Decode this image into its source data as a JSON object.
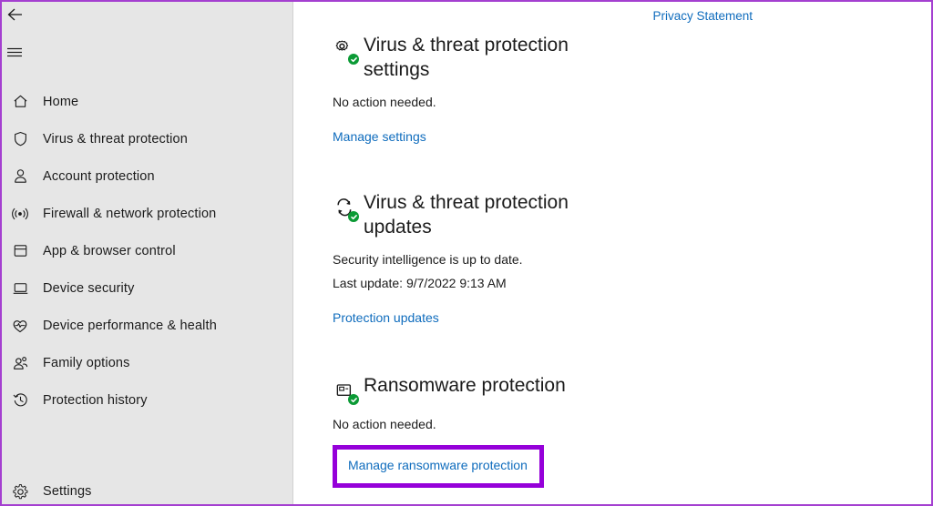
{
  "window": {
    "accent_highlight_color": "#9500d9",
    "window_border_color": "#a43fd0",
    "sidebar_bg": "#e6e6e6",
    "link_color": "#0f6cbd",
    "status_badge_color": "#0b9a35"
  },
  "sidebar": {
    "back_label": "Back",
    "menu_label": "Menu",
    "items": [
      {
        "label": "Home",
        "icon": "home-icon"
      },
      {
        "label": "Virus & threat protection",
        "icon": "shield-icon"
      },
      {
        "label": "Account protection",
        "icon": "person-icon"
      },
      {
        "label": "Firewall & network protection",
        "icon": "wireless-signal-icon"
      },
      {
        "label": "App & browser control",
        "icon": "app-window-icon"
      },
      {
        "label": "Device security",
        "icon": "monitor-icon"
      },
      {
        "label": "Device performance & health",
        "icon": "heart-pulse-icon"
      },
      {
        "label": "Family options",
        "icon": "people-icon"
      },
      {
        "label": "Protection history",
        "icon": "history-clock-icon"
      }
    ],
    "settings": {
      "label": "Settings",
      "icon": "gear-icon"
    }
  },
  "content": {
    "privacy_statement_link": "Privacy Statement",
    "sections": [
      {
        "title": "Virus & threat protection settings",
        "status": "No action needed.",
        "link": "Manage settings",
        "icon": "gear-check-icon"
      },
      {
        "title": "Virus & threat protection updates",
        "status": "Security intelligence is up to date.",
        "sub": "Last update: 9/7/2022 9:13 AM",
        "link": "Protection updates",
        "icon": "refresh-check-icon"
      },
      {
        "title": "Ransomware protection",
        "status": "No action needed.",
        "link": "Manage ransomware protection",
        "icon": "folder-lock-check-icon"
      }
    ]
  }
}
